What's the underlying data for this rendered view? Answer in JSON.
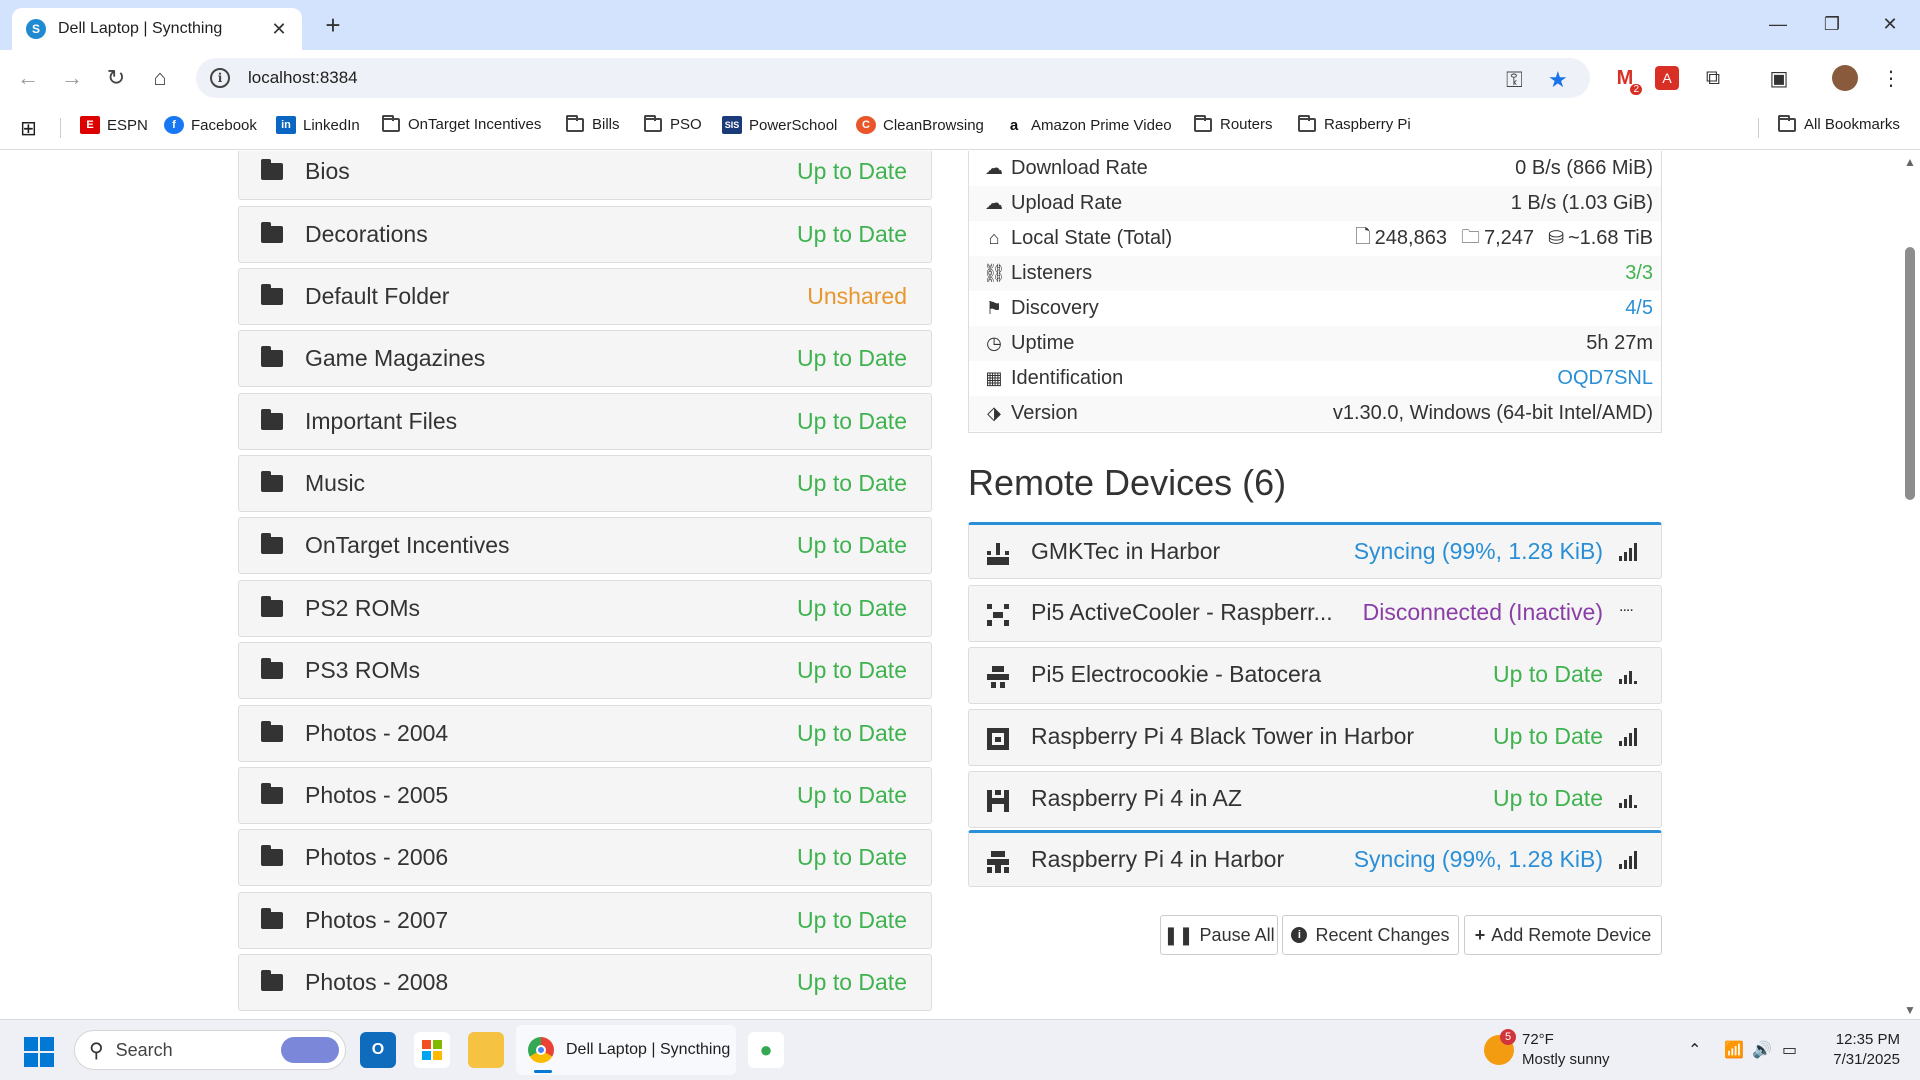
{
  "browser": {
    "tab_title": "Dell Laptop | Syncthing",
    "new_tab": "+",
    "url": "localhost:8384",
    "window_controls": [
      "minimize",
      "maximize",
      "close"
    ]
  },
  "bookmarks": [
    {
      "label": "ESPN",
      "icon": "espn-icon"
    },
    {
      "label": "Facebook",
      "icon": "facebook-icon"
    },
    {
      "label": "LinkedIn",
      "icon": "linkedin-icon"
    },
    {
      "label": "OnTarget Incentives",
      "icon": "folder-icon"
    },
    {
      "label": "Bills",
      "icon": "folder-icon"
    },
    {
      "label": "PSO",
      "icon": "folder-icon"
    },
    {
      "label": "PowerSchool",
      "icon": "powerschool-icon"
    },
    {
      "label": "CleanBrowsing",
      "icon": "cleanbrowsing-icon"
    },
    {
      "label": "Amazon Prime Video",
      "icon": "amazon-icon"
    },
    {
      "label": "Routers",
      "icon": "folder-icon"
    },
    {
      "label": "Raspberry Pi",
      "icon": "folder-icon"
    }
  ],
  "all_bookmarks": "All Bookmarks",
  "extension_badge": "2",
  "folders": [
    {
      "name": "Bios",
      "status": "Up to Date",
      "color": "#3fb34f"
    },
    {
      "name": "Decorations",
      "status": "Up to Date",
      "color": "#3fb34f"
    },
    {
      "name": "Default Folder",
      "status": "Unshared",
      "color": "#e8962e"
    },
    {
      "name": "Game Magazines",
      "status": "Up to Date",
      "color": "#3fb34f"
    },
    {
      "name": "Important Files",
      "status": "Up to Date",
      "color": "#3fb34f"
    },
    {
      "name": "Music",
      "status": "Up to Date",
      "color": "#3fb34f"
    },
    {
      "name": "OnTarget Incentives",
      "status": "Up to Date",
      "color": "#3fb34f"
    },
    {
      "name": "PS2 ROMs",
      "status": "Up to Date",
      "color": "#3fb34f"
    },
    {
      "name": "PS3 ROMs",
      "status": "Up to Date",
      "color": "#3fb34f"
    },
    {
      "name": "Photos - 2004",
      "status": "Up to Date",
      "color": "#3fb34f"
    },
    {
      "name": "Photos - 2005",
      "status": "Up to Date",
      "color": "#3fb34f"
    },
    {
      "name": "Photos - 2006",
      "status": "Up to Date",
      "color": "#3fb34f"
    },
    {
      "name": "Photos - 2007",
      "status": "Up to Date",
      "color": "#3fb34f"
    },
    {
      "name": "Photos - 2008",
      "status": "Up to Date",
      "color": "#3fb34f"
    }
  ],
  "this_device": {
    "download_rate": {
      "label": "Download Rate",
      "value": "0 B/s (866 MiB)"
    },
    "upload_rate": {
      "label": "Upload Rate",
      "value": "1 B/s (1.03 GiB)"
    },
    "local_state": {
      "label": "Local State (Total)",
      "files": "248,863",
      "dirs": "7,247",
      "size": "~1.68 TiB"
    },
    "listeners": {
      "label": "Listeners",
      "value": "3/3"
    },
    "discovery": {
      "label": "Discovery",
      "value": "4/5"
    },
    "uptime": {
      "label": "Uptime",
      "value": "5h 27m"
    },
    "identification": {
      "label": "Identification",
      "value": "OQD7SNL"
    },
    "version": {
      "label": "Version",
      "value": "v1.30.0, Windows (64-bit Intel/AMD)"
    }
  },
  "remote_devices": {
    "title": "Remote Devices (6)",
    "items": [
      {
        "name": "GMKTec in Harbor",
        "status": "Syncing (99%, 1.28 KiB)",
        "state": "syncing",
        "signal": 4
      },
      {
        "name": "Pi5 ActiveCooler - Raspberr...",
        "status": "Disconnected (Inactive)",
        "state": "disconnected",
        "signal": 0
      },
      {
        "name": "Pi5 Electrocookie - Batocera",
        "status": "Up to Date",
        "state": "uptodate",
        "signal": 3
      },
      {
        "name": "Raspberry Pi 4 Black Tower in Harbor",
        "status": "Up to Date",
        "state": "uptodate",
        "signal": 4
      },
      {
        "name": "Raspberry Pi 4 in AZ",
        "status": "Up to Date",
        "state": "uptodate",
        "signal": 3
      },
      {
        "name": "Raspberry Pi 4 in Harbor",
        "status": "Syncing (99%, 1.28 KiB)",
        "state": "syncing",
        "signal": 4
      }
    ]
  },
  "buttons": {
    "pause_all": "Pause All",
    "recent_changes": "Recent Changes",
    "add_remote_device": "Add Remote Device"
  },
  "taskbar": {
    "search_placeholder": "Search",
    "chrome_window_title": "Dell Laptop | Syncthing",
    "weather_temp": "72°F",
    "weather_desc": "Mostly sunny",
    "weather_badge": "5",
    "time": "12:35 PM",
    "date": "7/31/2025"
  }
}
